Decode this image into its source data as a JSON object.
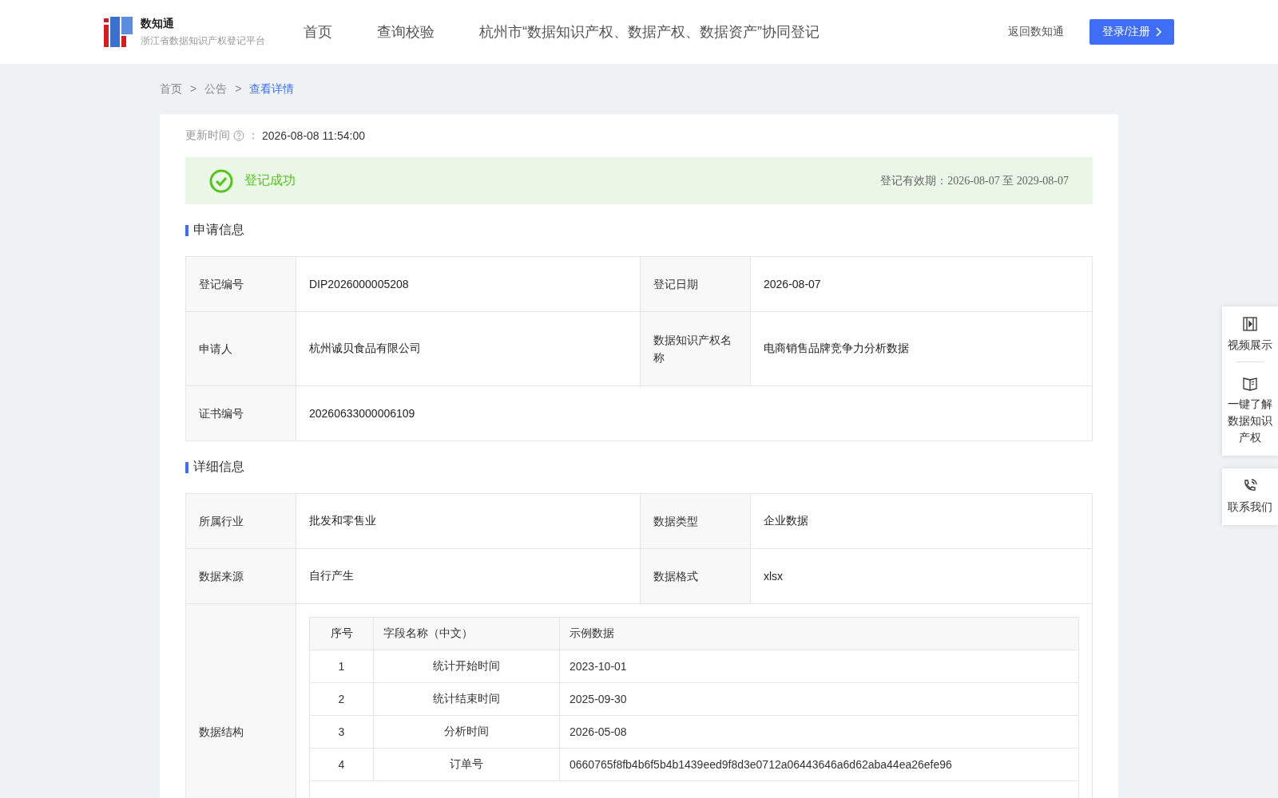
{
  "header": {
    "logo_title": "数知通",
    "logo_subtitle": "浙江省数据知识产权登记平台",
    "nav": [
      {
        "label": "首页",
        "selected": false
      },
      {
        "label": "查询校验",
        "selected": false
      },
      {
        "label": "杭州市“数据知识产权、数据产权、数据资产”协同登记",
        "selected": false
      }
    ],
    "back_link": "返回数知通",
    "login_button": "登录/注册"
  },
  "breadcrumb": [
    {
      "label": "首页",
      "selected": false
    },
    {
      "label": "公告",
      "selected": false
    },
    {
      "label": "查看详情",
      "selected": true
    }
  ],
  "breadcrumb_separator": ">",
  "update": {
    "label": "更新时间",
    "colon": "：",
    "value": "2026-08-08 11:54:00"
  },
  "status": {
    "kind": "success",
    "text": "登记成功",
    "validity": "登记有效期：2026-08-07 至 2029-08-07"
  },
  "sections": [
    {
      "title": "申请信息",
      "rows": [
        [
          {
            "label": "登记编号",
            "value": "DIP2026000005208"
          },
          {
            "label": "登记日期",
            "value": "2026-08-07"
          }
        ],
        [
          {
            "label": "申请人",
            "value": "杭州诚贝食品有限公司"
          },
          {
            "label": "数据知识产权名称",
            "value": "电商销售品牌竞争力分析数据"
          }
        ],
        [
          {
            "label": "证书编号",
            "value": "20260633000006109"
          }
        ]
      ]
    },
    {
      "title": "详细信息",
      "rows": [
        [
          {
            "label": "所属行业",
            "value": "批发和零售业"
          },
          {
            "label": "数据类型",
            "value": "企业数据"
          }
        ],
        [
          {
            "label": "数据来源",
            "value": "自行产生"
          },
          {
            "label": "数据格式",
            "value": "xlsx"
          }
        ]
      ],
      "structure": {
        "label": "数据结构",
        "columns": [
          "序号",
          "字段名称（中文）",
          "示例数据"
        ],
        "rows": [
          [
            "1",
            "统计开始时间",
            "2023-10-01"
          ],
          [
            "2",
            "统计结束时间",
            "2025-09-30"
          ],
          [
            "3",
            "分析时间",
            "2026-05-08"
          ],
          [
            "4",
            "订单号",
            "0660765f8fb4b6f5b4b1439eed9f8d3e0712a06443646a6d62aba44ea26efe96"
          ]
        ]
      }
    }
  ],
  "side_panel": [
    {
      "kind": "video",
      "label": "视频展示"
    },
    {
      "kind": "book",
      "label": "一键了解数据知识产权"
    },
    {
      "kind": "phone",
      "label": "联系我们"
    }
  ]
}
